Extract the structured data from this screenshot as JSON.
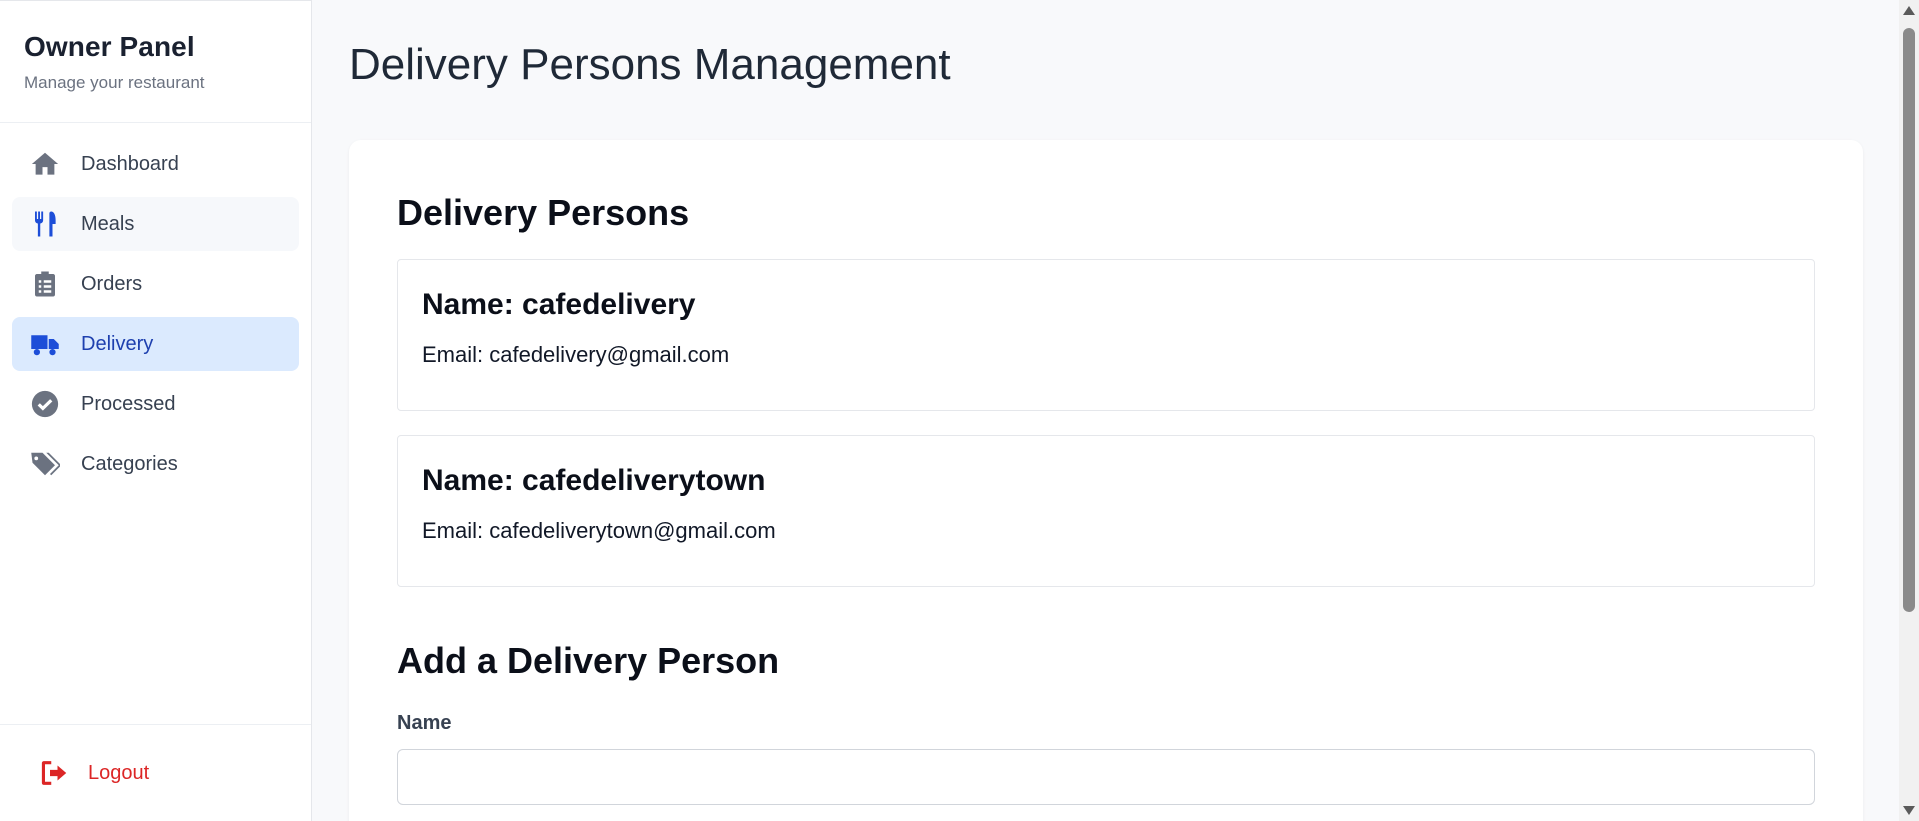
{
  "sidebar": {
    "title": "Owner Panel",
    "subtitle": "Manage your restaurant",
    "items": [
      {
        "label": "Dashboard",
        "icon": "home-icon"
      },
      {
        "label": "Meals",
        "icon": "utensils-icon"
      },
      {
        "label": "Orders",
        "icon": "clipboard-list-icon"
      },
      {
        "label": "Delivery",
        "icon": "truck-icon"
      },
      {
        "label": "Processed",
        "icon": "check-circle-icon"
      },
      {
        "label": "Categories",
        "icon": "tags-icon"
      }
    ],
    "active_item": "Delivery",
    "logout_label": "Logout"
  },
  "main": {
    "page_title": "Delivery Persons Management",
    "list_title": "Delivery Persons",
    "persons": [
      {
        "name": "Name: cafedelivery",
        "email": "Email: cafedelivery@gmail.com"
      },
      {
        "name": "Name: cafedeliverytown",
        "email": "Email: cafedeliverytown@gmail.com"
      }
    ],
    "form": {
      "title": "Add a Delivery Person",
      "name_label": "Name",
      "name_value": ""
    }
  },
  "colors": {
    "active_bg": "#dbeafe",
    "active_text": "#1e40af",
    "accent_blue": "#1d4ed8",
    "logout_red": "#dc2626",
    "icon_gray": "#6b7280"
  }
}
